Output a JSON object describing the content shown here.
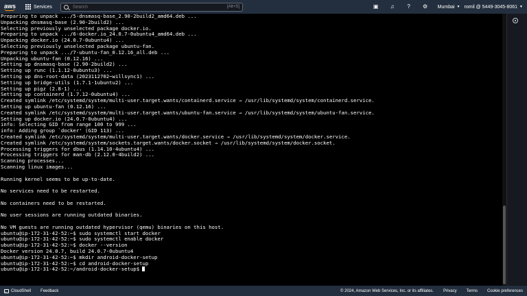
{
  "topnav": {
    "brand": "aws",
    "services_label": "Services",
    "search_placeholder": "Search",
    "search_shortcut": "[Alt+S]",
    "region": "Mumbai",
    "account": "romil @ 5449-3045-8061"
  },
  "terminal": {
    "lines": [
      "Preparing to unpack .../5-dnsmasq-base_2.90-2build2_amd64.deb ...",
      "Unpacking dnsmasq-base (2.90-2build2) ...",
      "Selecting previously unselected package docker.io.",
      "Preparing to unpack .../6-docker.io_24.0.7-0ubuntu4_amd64.deb ...",
      "Unpacking docker.io (24.0.7-0ubuntu4) ...",
      "Selecting previously unselected package ubuntu-fan.",
      "Preparing to unpack .../7-ubuntu-fan_0.12.16_all.deb ...",
      "Unpacking ubuntu-fan (0.12.16) ...",
      "Setting up dnsmasq-base (2.90-2build2) ...",
      "Setting up runc (1.1.12-0ubuntu3) ...",
      "Setting up dns-root-data (2023112702~willsync1) ...",
      "Setting up bridge-utils (1.7.1-1ubuntu2) ...",
      "Setting up pigz (2.8-1) ...",
      "Setting up containerd (1.7.12-0ubuntu4) ...",
      "Created symlink /etc/systemd/system/multi-user.target.wants/containerd.service → /usr/lib/systemd/system/containerd.service.",
      "Setting up ubuntu-fan (0.12.16) ...",
      "Created symlink /etc/systemd/system/multi-user.target.wants/ubuntu-fan.service → /usr/lib/systemd/system/ubuntu-fan.service.",
      "Setting up docker.io (24.0.7-0ubuntu4) ...",
      "info: Selecting GID from range 100 to 999 ...",
      "info: Adding group `docker' (GID 113) ...",
      "Created symlink /etc/systemd/system/multi-user.target.wants/docker.service → /usr/lib/systemd/system/docker.service.",
      "Created symlink /etc/systemd/system/sockets.target.wants/docker.socket → /usr/lib/systemd/system/docker.socket.",
      "Processing triggers for dbus (1.14.10-4ubuntu4) ...",
      "Processing triggers for man-db (2.12.0-4build2) ...",
      "Scanning processes...",
      "Scanning linux images...",
      "",
      "Running kernel seems to be up-to-date.",
      "",
      "No services need to be restarted.",
      "",
      "No containers need to be restarted.",
      "",
      "No user sessions are running outdated binaries.",
      "",
      "No VM guests are running outdated hypervisor (qemu) binaries on this host.",
      "ubuntu@ip-172-31-42-52:~$ sudo systemctl start docker",
      "ubuntu@ip-172-31-42-52:~$ sudo systemctl enable docker",
      "ubuntu@ip-172-31-42-52:~$ docker --version",
      "Docker version 24.0.7, build 24.0.7-0ubuntu4",
      "ubuntu@ip-172-31-42-52:~$ mkdir android-docker-setup",
      "ubuntu@ip-172-31-42-52:~$ cd android-docker-setup",
      "ubuntu@ip-172-31-42-52:~/android-docker-setup$ "
    ]
  },
  "footer": {
    "cloudshell": "CloudShell",
    "feedback": "Feedback",
    "copyright": "© 2024, Amazon Web Services, Inc. or its affiliates.",
    "privacy": "Privacy",
    "terms": "Terms",
    "cookies": "Cookie preferences"
  }
}
